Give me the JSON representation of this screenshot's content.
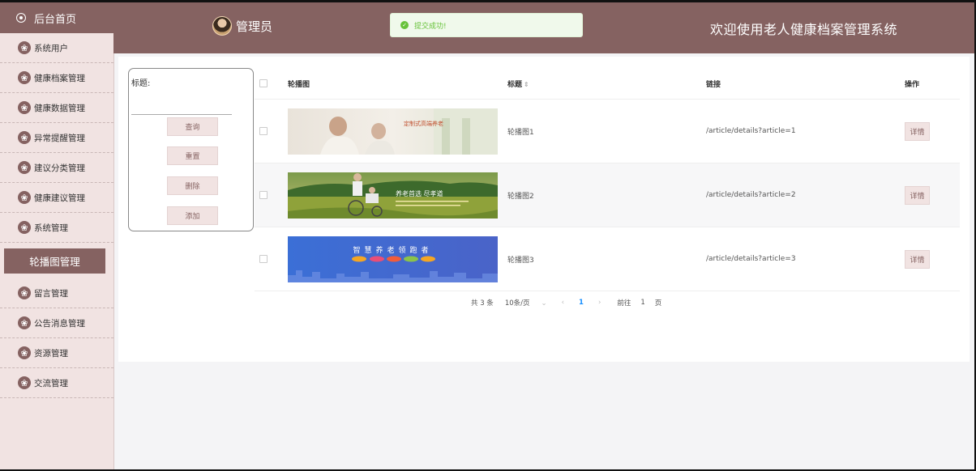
{
  "sidebar": {
    "home_label": "后台首页",
    "items": [
      {
        "label": "系统用户"
      },
      {
        "label": "健康档案管理"
      },
      {
        "label": "健康数据管理"
      },
      {
        "label": "异常提醒管理"
      },
      {
        "label": "建议分类管理"
      },
      {
        "label": "健康建议管理"
      },
      {
        "label": "系统管理"
      }
    ],
    "active_item": "轮播图管理",
    "items_after": [
      {
        "label": "留言管理"
      },
      {
        "label": "公告消息管理"
      },
      {
        "label": "资源管理"
      },
      {
        "label": "交流管理"
      }
    ],
    "icon_glyph": "❀"
  },
  "header": {
    "admin_label": "管理员",
    "welcome": "欢迎使用老人健康档案管理系统",
    "toast": "提交成功!"
  },
  "search": {
    "label": "标题:",
    "value": "",
    "buttons": {
      "query": "查询",
      "reset": "重置",
      "delete": "删除",
      "add": "添加"
    }
  },
  "table": {
    "headers": {
      "image": "轮播图",
      "title": "标题",
      "link": "链接",
      "action": "操作"
    },
    "rows": [
      {
        "title": "轮播图1",
        "link": "/article/details?article=1",
        "action": "详情",
        "banner_text": "定制式高端养老"
      },
      {
        "title": "轮播图2",
        "link": "/article/details?article=2",
        "action": "详情",
        "banner_text": "养老首选 尽孝道"
      },
      {
        "title": "轮播图3",
        "link": "/article/details?article=3",
        "action": "详情",
        "banner_text": "智慧养老领跑者"
      }
    ]
  },
  "pagination": {
    "total": "共 3 条",
    "page_size": "10条/页",
    "current_page": "1",
    "goto_label": "前往",
    "goto_value": "1",
    "page_unit": "页"
  },
  "colors": {
    "brand": "#856261",
    "sidebar_bg": "#f1e3e2",
    "success": "#67c23a",
    "link_blue": "#1890ff"
  }
}
